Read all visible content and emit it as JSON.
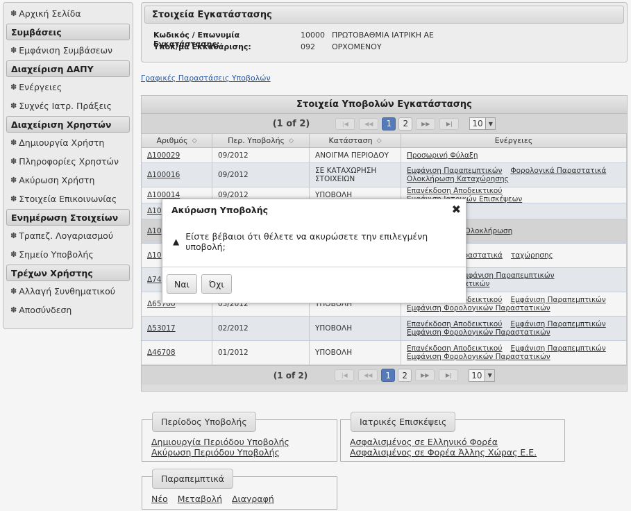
{
  "sidebar": {
    "items": [
      {
        "kind": "item",
        "label": "Αρχική Σελίδα"
      },
      {
        "kind": "head",
        "label": "Συμβάσεις"
      },
      {
        "kind": "item",
        "label": "Εμφάνιση Συμβάσεων"
      },
      {
        "kind": "head",
        "label": "Διαχείριση ΔΑΠΥ"
      },
      {
        "kind": "item",
        "label": "Ενέργειες"
      },
      {
        "kind": "item",
        "label": "Συχνές Ιατρ. Πράξεις"
      },
      {
        "kind": "head",
        "label": "Διαχείριση Χρηστών"
      },
      {
        "kind": "item",
        "label": "Δημιουργία Χρήστη"
      },
      {
        "kind": "item",
        "label": "Πληροφορίες Χρηστών"
      },
      {
        "kind": "item",
        "label": "Ακύρωση Χρήστη"
      },
      {
        "kind": "item",
        "label": "Στοιχεία Επικοινωνίας"
      },
      {
        "kind": "head",
        "label": "Ενημέρωση Στοιχείων"
      },
      {
        "kind": "item",
        "label": "Τραπεζ. Λογαριασμού"
      },
      {
        "kind": "item",
        "label": "Σημείο Υποβολής"
      },
      {
        "kind": "head",
        "label": "Τρέχων Χρήστης"
      },
      {
        "kind": "item",
        "label": "Αλλαγή Συνθηματικού"
      },
      {
        "kind": "item",
        "label": "Αποσύνδεση"
      }
    ]
  },
  "installation": {
    "title": "Στοιχεία Εγκατάστασης",
    "row1": {
      "label": "Κωδικός / Επωνυμία Εγκατάστασης:",
      "code": "10000",
      "name": "ΠΡΩΤΟΒΑΘΜΙΑ ΙΑΤΡΙΚΗ ΑΕ"
    },
    "row2": {
      "label": "Υποκ/μα Εκκαθάρισης:",
      "code": "092",
      "name": "ΟΡΧΟΜΕΝΟΥ"
    }
  },
  "graphs_link": "Γραφικές Παραστάσεις Υποβολών",
  "table": {
    "title": "Στοιχεία Υποβολών Εγκατάστασης",
    "pager": {
      "info": "(1 of 2)",
      "pages": [
        "1",
        "2"
      ],
      "page_size": "10"
    },
    "columns": [
      "Αριθμός",
      "Περ. Υποβολής",
      "Κατάσταση",
      "Ενέργειες"
    ],
    "rows": [
      {
        "id": "Δ100029",
        "period": "09/2012",
        "status": "ΑΝΟΙΓΜΑ ΠΕΡΙΟΔΟΥ",
        "actions": [
          "Προσωρινή Φύλαξη"
        ]
      },
      {
        "id": "Δ100016",
        "period": "09/2012",
        "status": "ΣΕ ΚΑΤΑΧΩΡΗΣΗ ΣΤΟΙΧΕΙΩΝ",
        "actions": [
          "Εμφάνιση Παραπεμπτικών",
          "Φορολογικά Παραστατικά",
          "Ολοκλήρωση Καταχώρησης"
        ]
      },
      {
        "id": "Δ100014",
        "period": "09/2012",
        "status": "ΥΠΟΒΟΛΗ",
        "actions": [
          "Επανέκδοση Αποδεικτικού",
          "Εμφάνιση Ιατρικών Επισκέψεων"
        ]
      },
      {
        "id": "Δ10",
        "period": "",
        "status": "",
        "actions": [
          "ιή"
        ]
      },
      {
        "id": "Δ10",
        "period": "",
        "status": "",
        "actions": [
          "ν Επισκέψεων",
          "Ολοκλήρωση"
        ]
      },
      {
        "id": "Δ10",
        "period": "",
        "status": "",
        "actions": [
          "Φορολογικά Παραστατικά",
          "ταχώρησης"
        ]
      },
      {
        "id": "Δ74",
        "period": "",
        "status": "",
        "actions": [
          "ποδεικτικού",
          "Εμφάνιση Παραπεμπτικών",
          "ογικών Παραστατικών"
        ]
      },
      {
        "id": "Δ65700",
        "period": "03/2012",
        "status": "ΥΠΟΒΟΛΗ",
        "actions": [
          "Επανέκδοση Αποδεικτικού",
          "Εμφάνιση Παραπεμπτικών",
          "Εμφάνιση Φορολογικών Παραστατικών"
        ]
      },
      {
        "id": "Δ53017",
        "period": "02/2012",
        "status": "ΥΠΟΒΟΛΗ",
        "actions": [
          "Επανέκδοση Αποδεικτικού",
          "Εμφάνιση Παραπεμπτικών",
          "Εμφάνιση Φορολογικών Παραστατικών"
        ]
      },
      {
        "id": "Δ46708",
        "period": "01/2012",
        "status": "ΥΠΟΒΟΛΗ",
        "actions": [
          "Επανέκδοση Αποδεικτικού",
          "Εμφάνιση Παραπεμπτικών",
          "Εμφάνιση Φορολογικών Παραστατικών"
        ]
      }
    ]
  },
  "fieldsets": {
    "period": {
      "legend": "Περίοδος Υποβολής",
      "links": [
        "Δημιουργία Περιόδου Υποβολής",
        "Ακύρωση Περιόδου Υποβολής"
      ]
    },
    "visits": {
      "legend": "Ιατρικές Επισκέψεις",
      "links": [
        "Ασφαλισμένος σε Ελληνικό Φορέα",
        "Ασφαλισμένος σε Φορέα Άλλης Χώρας Ε.Ε."
      ]
    },
    "referrals": {
      "legend": "Παραπεμπτικά",
      "links": [
        "Νέο",
        "Μεταβολή",
        "Διαγραφή"
      ]
    }
  },
  "dialog": {
    "title": "Ακύρωση Υποβολής",
    "message": "Είστε βέβαιοι ότι θέλετε να ακυρώσετε την επιλεγμένη υποβολή;",
    "yes": "Ναι",
    "no": "Όχι"
  },
  "icons": {
    "menu": "gear-icon",
    "warning": "warning-icon",
    "close": "close-icon"
  }
}
